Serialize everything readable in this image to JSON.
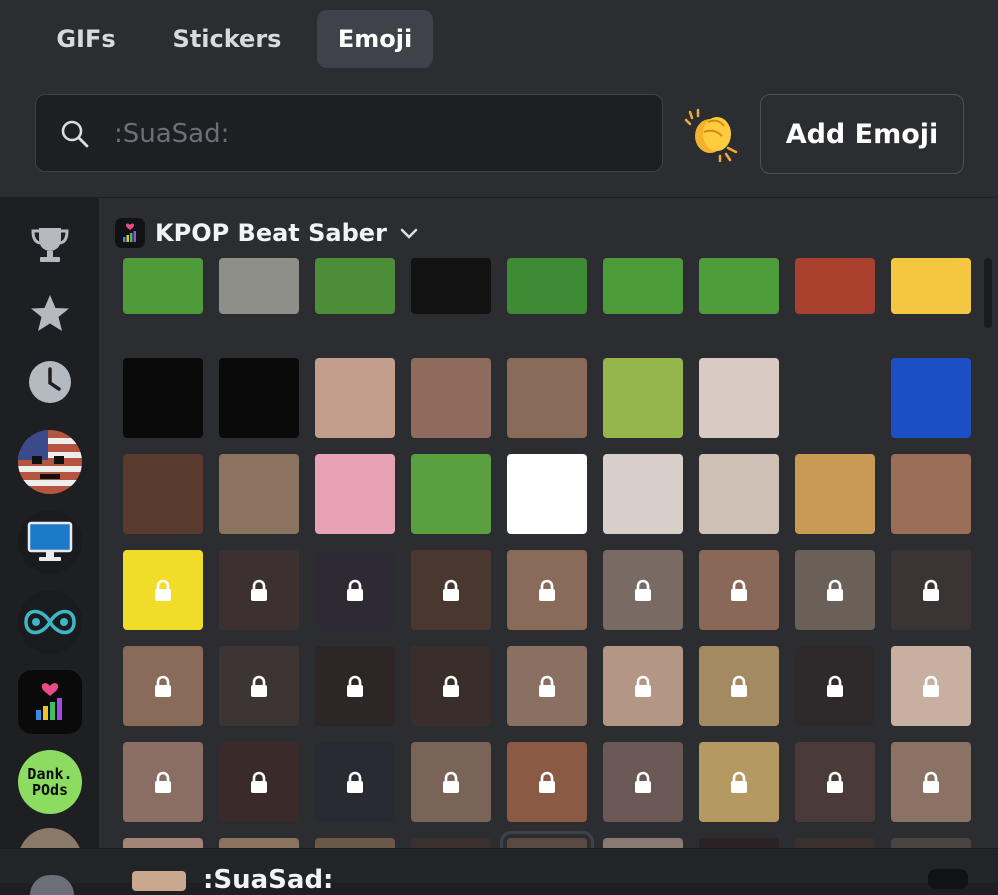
{
  "tabs": [
    {
      "label": "GIFs",
      "active": false
    },
    {
      "label": "Stickers",
      "active": false
    },
    {
      "label": "Emoji",
      "active": true
    }
  ],
  "search": {
    "placeholder": ":SuaSad:",
    "value": ""
  },
  "add_emoji_label": "Add Emoji",
  "categories": [
    {
      "name": "trophy-icon"
    },
    {
      "name": "star-icon"
    },
    {
      "name": "clock-icon"
    },
    {
      "name": "server-flag-face"
    },
    {
      "name": "server-monitor"
    },
    {
      "name": "server-infinity"
    },
    {
      "name": "server-kpop-beat-saber"
    },
    {
      "name": "server-dank-pods",
      "label": "Dank. POds"
    }
  ],
  "section": {
    "title": "KPOP Beat Saber"
  },
  "emoji_rows": [
    [
      "#4f9a3a",
      "#8f8f8a",
      "#4e8d37",
      "#121212",
      "#3f8a34",
      "#4d9a3a",
      "#4e9c3b",
      "#a8402d",
      "#f4c642"
    ],
    [
      "#0a0a0a",
      "#0a0a0a",
      "#c49e8c",
      "#8f6b5e",
      "#8a6a58",
      "#94b64c",
      "#d9cbc4",
      "#2b2d31",
      "#1d4fc4"
    ],
    [
      "#5a3a2d",
      "#8a7460",
      "#e8a1b5",
      "#5aa041",
      "#ffffff",
      "#d8d0c8",
      "#cfc0b5",
      "#c89a55",
      "#9a6e58"
    ],
    [
      "#f2dc2a",
      "#3d3030",
      "#2d2a33",
      "#4a3830",
      "#8a6a58",
      "#7a6a64",
      "#8a6858",
      "#6a6058",
      "#3a3435"
    ],
    [
      "#8a6a58",
      "#3d3533",
      "#2d2626",
      "#3a2e2a",
      "#8a7060",
      "#b49684",
      "#a48a60",
      "#2e2a2c",
      "#c8b0a0"
    ],
    [
      "#8a6e64",
      "#3a2a2a",
      "#2a2a33",
      "#7a6458",
      "#8a5a44",
      "#6a5854",
      "#b49a60",
      "#4a3a38",
      "#8a7264"
    ],
    [
      "#a48476",
      "#8a7460",
      "#6a5848",
      "#3a302e",
      "#5a4a44",
      "#8a7a74",
      "#2a2224",
      "#3a302c",
      "#4a4440"
    ]
  ],
  "locked_rows": [
    3,
    4,
    5,
    6
  ],
  "highlight": {
    "row": 6,
    "col": 4
  },
  "preview": {
    "name": ":SuaSad:"
  }
}
